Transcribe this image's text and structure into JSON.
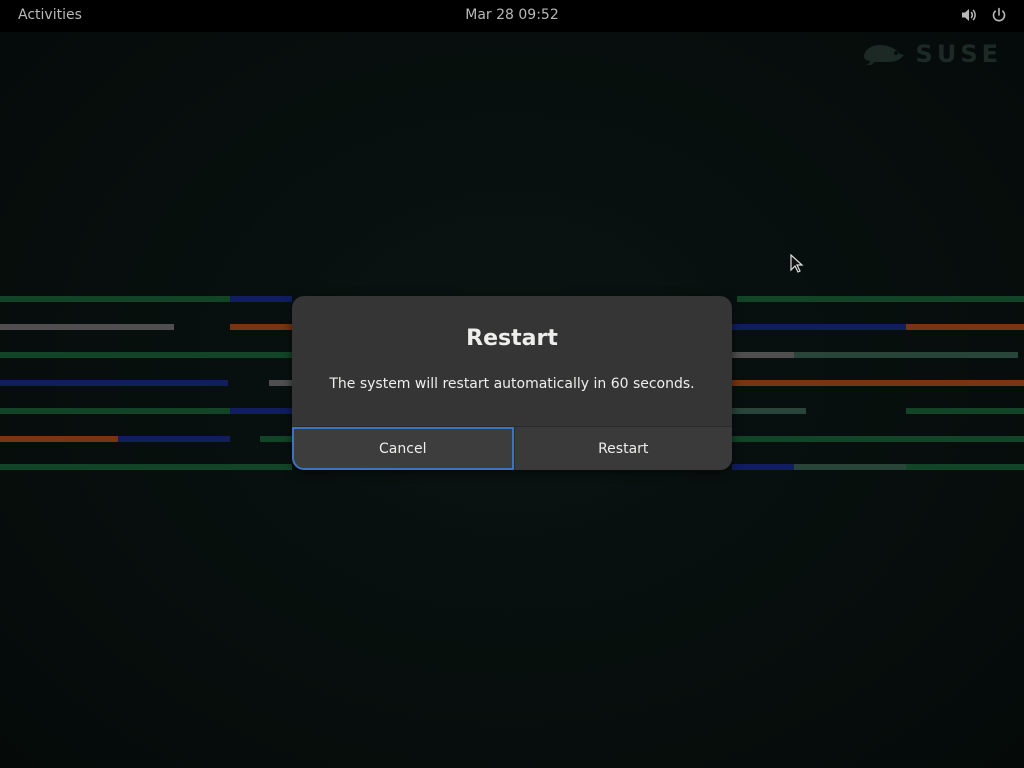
{
  "topbar": {
    "activities_label": "Activities",
    "clock": "Mar 28  09:52"
  },
  "branding": {
    "wordmark": "SUSE",
    "logo_color": "#2b3f38"
  },
  "dialog": {
    "title": "Restart",
    "message": "The system will restart automatically in 60 seconds.",
    "cancel_label": "Cancel",
    "restart_label": "Restart"
  },
  "colors": {
    "panel_bg": "#000000",
    "dialog_bg": "#353535",
    "focus_ring": "#3a74c2",
    "stripe_green": "#1d6a3e",
    "stripe_blue": "#1a2e8f",
    "stripe_orange": "#b8501f",
    "stripe_gray": "#7a7a7a",
    "stripe_teal": "#3f6a5a"
  },
  "icons": {
    "volume": "volume-icon",
    "power": "power-icon",
    "cursor": "mouse-pointer-icon"
  }
}
